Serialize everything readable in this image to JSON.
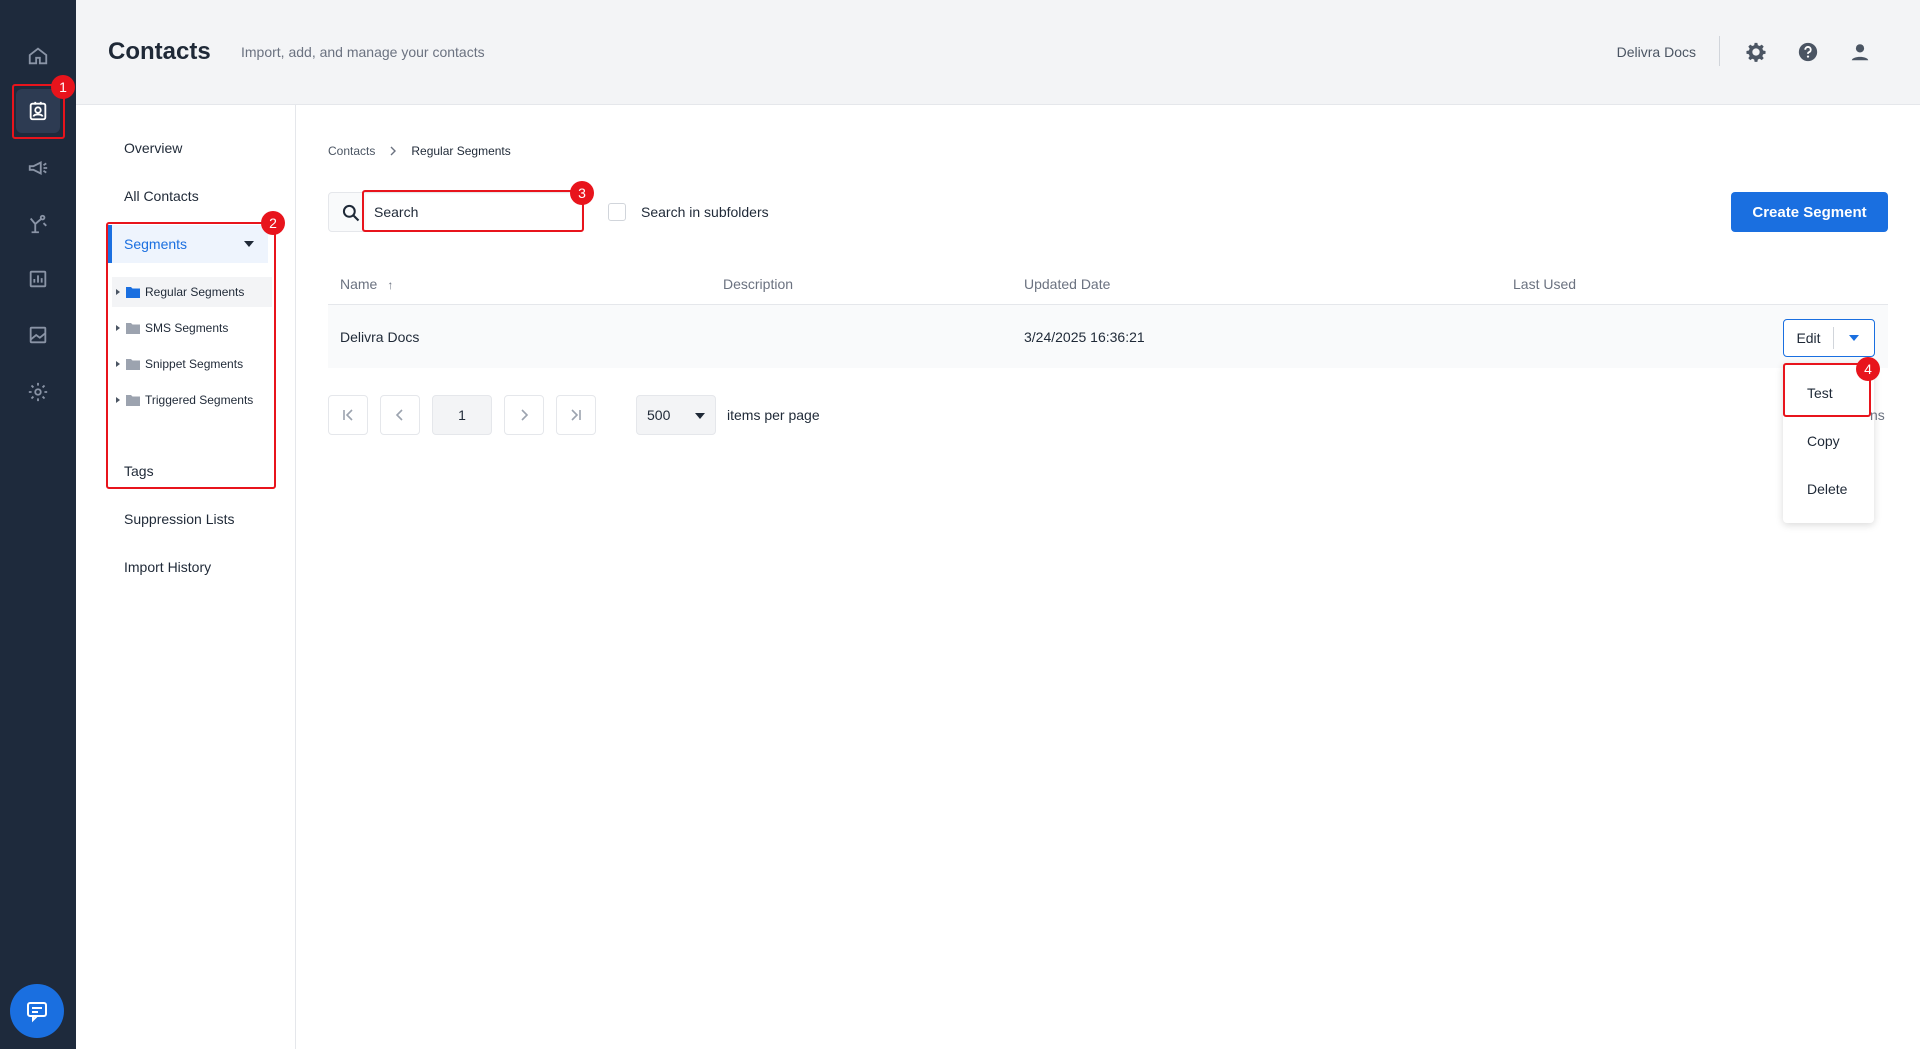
{
  "header": {
    "title": "Contacts",
    "subtitle": "Import, add, and manage your contacts",
    "account": "Delivra Docs"
  },
  "rail": {
    "items": [
      "home-icon",
      "contacts-icon",
      "megaphone-icon",
      "automation-icon",
      "reports-icon",
      "media-icon",
      "settings-icon"
    ],
    "active": "contacts-icon"
  },
  "subnav": {
    "overview": "Overview",
    "all_contacts": "All Contacts",
    "segments": "Segments",
    "folders": [
      "Regular Segments",
      "SMS Segments",
      "Snippet Segments",
      "Triggered Segments"
    ],
    "tags": "Tags",
    "suppression": "Suppression Lists",
    "import_history": "Import History"
  },
  "breadcrumb": {
    "root": "Contacts",
    "current": "Regular Segments"
  },
  "toolbar": {
    "search_placeholder": "Search",
    "search_subfolders": "Search in subfolders",
    "create_label": "Create Segment"
  },
  "table": {
    "columns": [
      "Name",
      "Description",
      "Updated Date",
      "Last Used"
    ],
    "rows": [
      {
        "name": "Delivra Docs",
        "description": "",
        "updated": "3/24/2025 16:36:21",
        "last_used": ""
      }
    ],
    "edit_label": "Edit"
  },
  "row_menu": {
    "items": [
      "Test",
      "Copy",
      "Delete"
    ]
  },
  "pagination": {
    "page": "1",
    "per_page": "500",
    "per_page_label": "items per page",
    "count_fragment": "ns"
  },
  "annotations": [
    "1",
    "2",
    "3",
    "4"
  ],
  "colors": {
    "accent": "#1a6fe0",
    "rail": "#1e2a3c",
    "annotation": "#e8141c"
  }
}
